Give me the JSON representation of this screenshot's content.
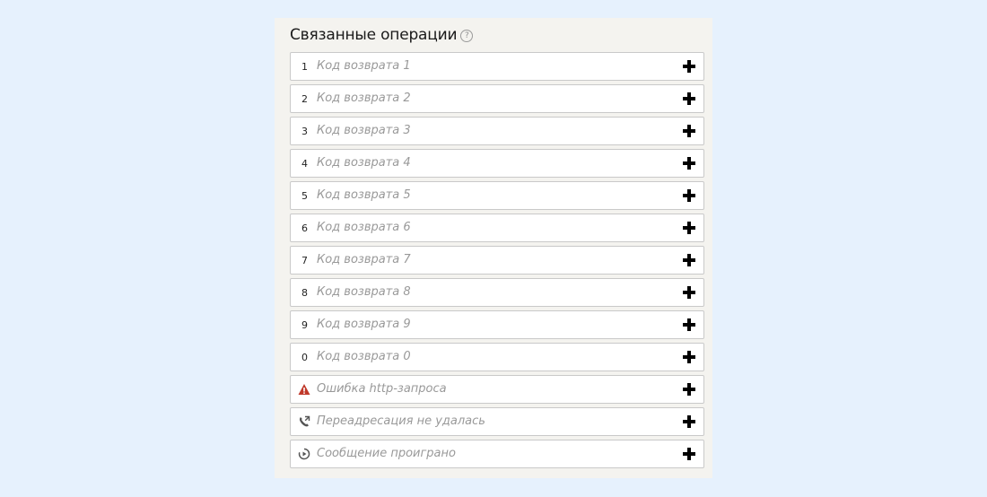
{
  "panel": {
    "title": "Связанные операции",
    "help_symbol": "?"
  },
  "rows": [
    {
      "key": "1",
      "label": "Код возврата 1"
    },
    {
      "key": "2",
      "label": "Код возврата 2"
    },
    {
      "key": "3",
      "label": "Код возврата 3"
    },
    {
      "key": "4",
      "label": "Код возврата 4"
    },
    {
      "key": "5",
      "label": "Код возврата 5"
    },
    {
      "key": "6",
      "label": "Код возврата 6"
    },
    {
      "key": "7",
      "label": "Код возврата 7"
    },
    {
      "key": "8",
      "label": "Код возврата 8"
    },
    {
      "key": "9",
      "label": "Код возврата 9"
    },
    {
      "key": "0",
      "label": "Код возврата 0"
    },
    {
      "icon": "warning-icon",
      "icon_color": "#c0392b",
      "label": "Ошибка http-запроса"
    },
    {
      "icon": "phone-forward-icon",
      "icon_color": "#555555",
      "label": "Переадресация не удалась"
    },
    {
      "icon": "play-circle-icon",
      "icon_color": "#555555",
      "label": "Сообщение проиграно"
    }
  ],
  "colors": {
    "background": "#e6f1fd",
    "panel": "#f4f3ef",
    "row_border": "#c9c9c9",
    "placeholder_text": "#999999"
  }
}
